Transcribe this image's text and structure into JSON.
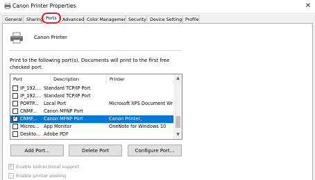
{
  "window": {
    "title": "Canon Printer Properties",
    "close_glyph": "✕"
  },
  "tabs": [
    {
      "label": "General"
    },
    {
      "label": "Sharing"
    },
    {
      "label": "Ports",
      "active": true
    },
    {
      "label": "Advanced"
    },
    {
      "label": "Color Management"
    },
    {
      "label": "Security"
    },
    {
      "label": "Device Settings"
    },
    {
      "label": "Profile"
    }
  ],
  "printer": {
    "name": "Canon Printer",
    "icon": "printer-icon"
  },
  "description": {
    "line1": "Print to the following port(s). Documents will print to the first free",
    "line2": "checked port."
  },
  "ports_list": {
    "headers": {
      "port": "Port",
      "description": "Description",
      "printer": "Printer"
    },
    "rows": [
      {
        "port": "IP_192....",
        "description": "Standard TCP/IP Port",
        "printer": "",
        "checked": false,
        "selected": false
      },
      {
        "port": "IP_192....",
        "description": "Standard TCP/IP Port",
        "printer": "",
        "checked": false,
        "selected": false
      },
      {
        "port": "PORTP...",
        "description": "Local Port",
        "printer": "Microsoft XPS Document Write...",
        "checked": false,
        "selected": false
      },
      {
        "port": "CNMF...",
        "description": "Canon MFNP Port",
        "printer": "",
        "checked": false,
        "selected": false
      },
      {
        "port": "CNMF...",
        "description": "Canon MFNP Port",
        "printer": "Canon Printer,",
        "checked": true,
        "selected": true
      },
      {
        "port": "Micros...",
        "description": "App Monitor",
        "printer": "OneNote for Windows 10",
        "checked": false,
        "selected": false
      },
      {
        "port": "Deskto...",
        "description": "Adobe PDF",
        "printer": "",
        "checked": false,
        "selected": false
      }
    ],
    "scroll_up_glyph": "▲",
    "scroll_down_glyph": "▼"
  },
  "buttons": {
    "add_port": "Add Port...",
    "delete_port": "Delete Port",
    "configure_port": "Configure Port..."
  },
  "options": {
    "bidirectional": {
      "label": "Enable bidirectional support",
      "checked": true
    },
    "pooling": {
      "label": "Enable printer pooling",
      "checked": false
    }
  },
  "colors": {
    "selection": "#0078d7",
    "highlight_ring": "#d4252e"
  }
}
